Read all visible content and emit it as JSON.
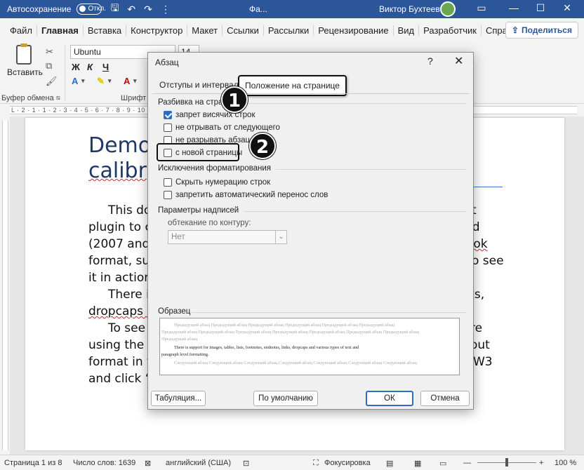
{
  "titlebar": {
    "autosave_label": "Автосохранение",
    "toggle_state": "Откл.",
    "doc_title": "Фа...",
    "user_name": "Виктор Бухтеев"
  },
  "menu": {
    "tabs": [
      "Файл",
      "Главная",
      "Вставка",
      "Конструктор",
      "Макет",
      "Ссылки",
      "Рассылки",
      "Рецензирование",
      "Вид",
      "Разработчик",
      "Справка"
    ],
    "active_tab": "Главная",
    "share_label": "Поделиться"
  },
  "ribbon": {
    "paste_label": "Вставить",
    "clipboard_group": "Буфер обмена",
    "font_group": "Шрифт",
    "font_name": "Ubuntu",
    "font_size": "14",
    "format_buttons": [
      "Ж",
      "К",
      "Ч"
    ]
  },
  "ruler": {
    "text": "L · 2 · 1 · 1 · 2 · 3 · 4 · 5 · 6 · 7 · 8 · 9 · 10 · 11 · 12 · 13 · 14 · 15 · 16 · 17 · 18 ·"
  },
  "document": {
    "heading_line1": "Demo",
    "heading_line2": "calibr",
    "lines_left": [
      "This do",
      "plugin to c",
      "(2007 and",
      "format, suc",
      "it in action",
      "There is",
      "dropcaps a",
      "To see t",
      "using the “",
      "format in t",
      "and click “("
    ],
    "lines_right": [
      "t",
      "rd",
      "ook",
      "o see",
      "ks,",
      "re",
      "out",
      "W3"
    ]
  },
  "statusbar": {
    "page": "Страница 1 из 8",
    "words": "Число слов: 1639",
    "language": "английский (США)",
    "focus": "Фокусировка",
    "zoom": "100 %"
  },
  "dialog": {
    "title": "Абзац",
    "help": "?",
    "close": "✕",
    "tab_indents": "Отступы и интервалы",
    "tab_position": "Положение на странице",
    "section_pagination": "Разбивка на страницы",
    "cb_widow": "запрет висячих строк",
    "cb_keep_next": "не отрывать от следующего",
    "cb_keep_lines": "не разрывать абзац",
    "cb_page_break": "с новой страницы",
    "section_exceptions": "Исключения форматирования",
    "cb_suppress_numbers": "Скрыть нумерацию строк",
    "cb_no_hyphen": "запретить автоматический перенос слов",
    "section_textbox": "Параметры надписей",
    "wrap_label": "обтекание по контуру:",
    "wrap_value": "Нет",
    "section_preview": "Образец",
    "preview_prev": "Предыдущий абзац Предыдущий абзац Предыдущий абзац Предыдущий абзац Предыдущий абзац Предыдущий абзац",
    "preview_prev2": "Предыдущий абзац Предыдущий абзац Предыдущий абзац Предыдущий абзац Предыдущий абзац Предыдущий абзац Предыдущий абзац",
    "preview_prev3": "Предыдущий абзац",
    "preview_cur1": "There is support for images, tables, lists, footnotes, endnotes, links, dropcaps and various types of text and",
    "preview_cur2": "paragraph level formatting.",
    "preview_next": "Следующий абзац Следующий абзац Следующий абзац Следующий абзац Следующий абзац Следующий абзац Следующий абзац",
    "btn_tabs": "Табуляция...",
    "btn_default": "По умолчанию",
    "btn_ok": "ОК",
    "btn_cancel": "Отмена",
    "badge1": "1",
    "badge2": "2"
  },
  "colors": {
    "titlebar_bg": "#2b579a",
    "heading": "#1f3864",
    "checkbox_checked": "#2b6cc4"
  }
}
